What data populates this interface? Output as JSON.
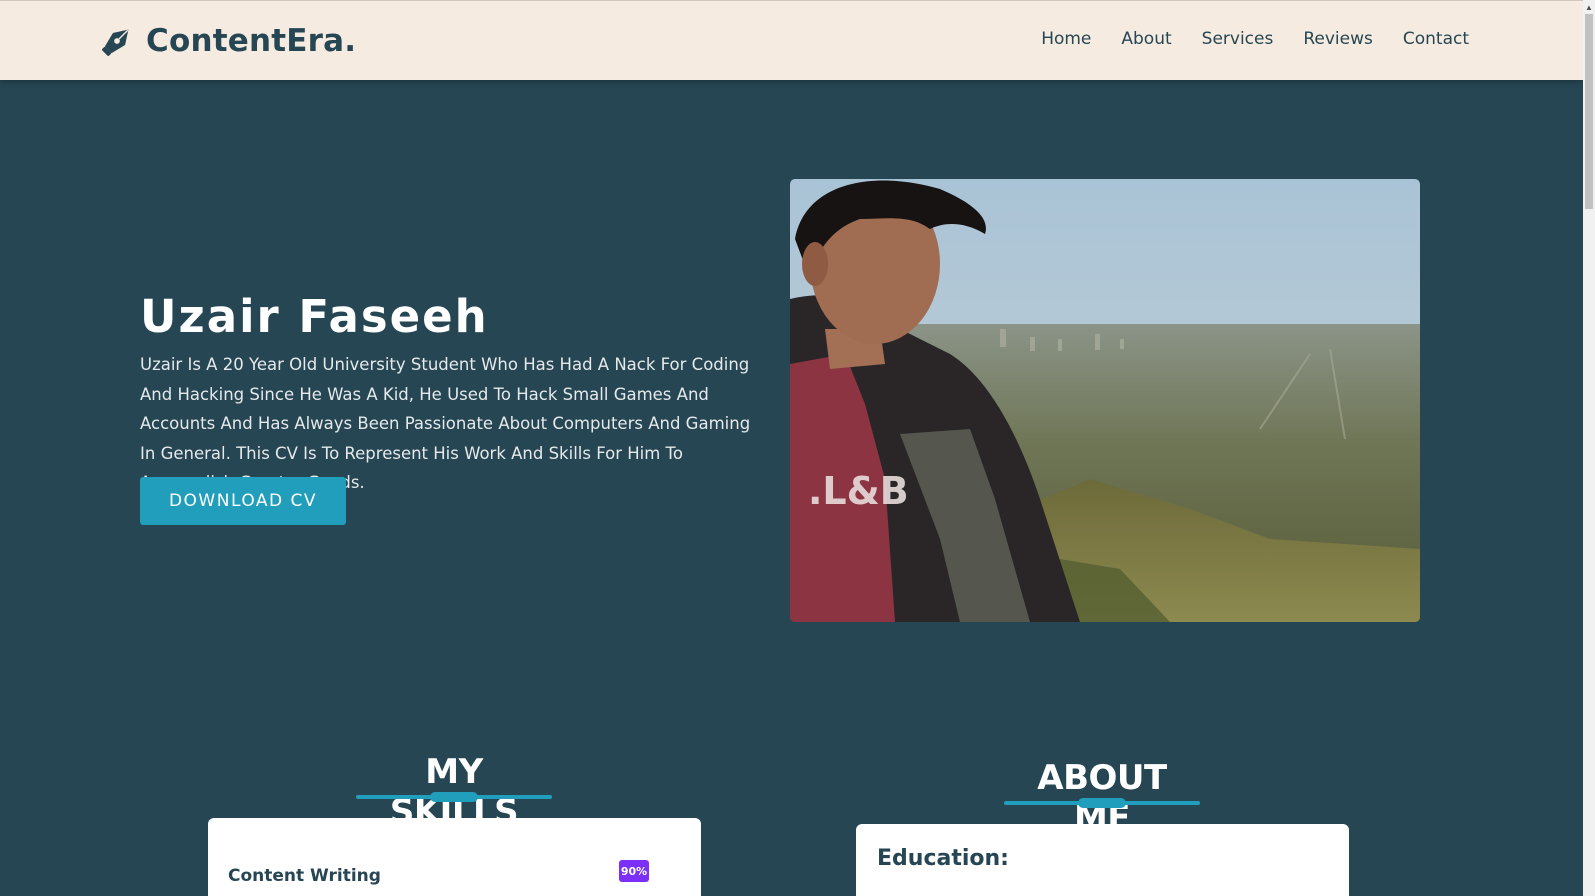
{
  "header": {
    "logo_text": "ContentEra.",
    "logo_icon": "pen-nib-icon",
    "nav": [
      "Home",
      "About",
      "Services",
      "Reviews",
      "Contact"
    ]
  },
  "hero": {
    "name": "Uzair Faseeh",
    "description": "Uzair Is A 20 Year Old University Student Who Has Had A Nack For Coding And Hacking Since He Was A Kid, He Used To Hack Small Games And Accounts And Has Always Been Passionate About Computers And Gaming In General. This CV Is To Represent His Work And Skills For Him To Accomplish Greater Goods.",
    "button_label": "DOWNLOAD CV"
  },
  "skills": {
    "title": "MY SKILLS",
    "items": [
      {
        "name": "Content Writing",
        "percent": "90%"
      }
    ]
  },
  "about": {
    "title": "ABOUT ME",
    "education_label": "Education:"
  },
  "colors": {
    "background": "#264653",
    "header_bg": "#f6ebe0",
    "accent": "#219ebc",
    "badge": "#7b2ff7"
  }
}
